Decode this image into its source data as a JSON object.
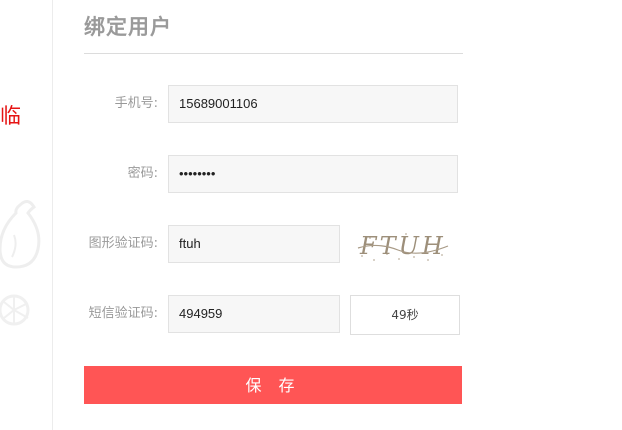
{
  "left_edge": {
    "text": "临"
  },
  "form": {
    "title": "绑定用户",
    "phone": {
      "label": "手机号:",
      "value": "15689001106"
    },
    "password": {
      "label": "密码:",
      "value": "••••••••"
    },
    "captcha": {
      "label": "图形验证码:",
      "value": "ftuh",
      "image_text": "FTUH"
    },
    "sms": {
      "label": "短信验证码:",
      "value": "494959",
      "countdown": "49秒"
    },
    "save_label": "保 存"
  },
  "colors": {
    "accent": "#ff5555",
    "left_text": "#e61414"
  }
}
